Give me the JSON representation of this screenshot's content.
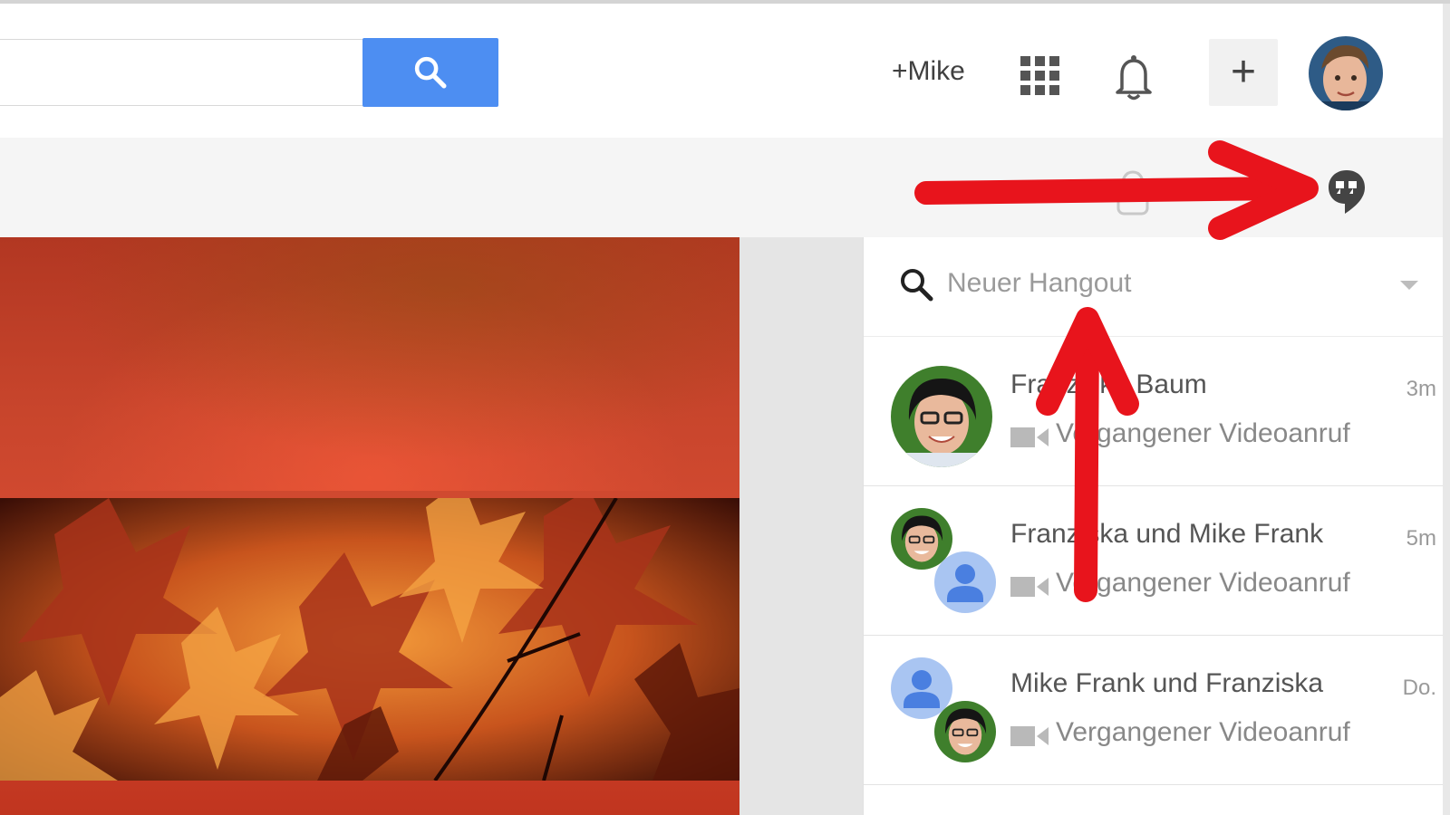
{
  "header": {
    "search_placeholder": "",
    "profile_link": "+Mike",
    "icons": [
      "search-icon",
      "apps-grid-icon",
      "notifications-bell-icon",
      "share-plus-icon",
      "avatar"
    ]
  },
  "toolbar": {
    "icons": [
      "hangouts-icon"
    ]
  },
  "hangouts": {
    "search_placeholder": "Neuer Hangout",
    "conversations": [
      {
        "title": "Franziska Baum",
        "time": "3m",
        "subtitle": "Vergangener Videoanruf"
      },
      {
        "title": "Franziska und Mike Frank",
        "time": "5m",
        "subtitle": "Vergangener Videoanruf"
      },
      {
        "title": "Mike Frank und Franziska",
        "time": "Do.",
        "subtitle": "Vergangener Videoanruf"
      }
    ]
  },
  "colors": {
    "search_button": "#4d8ef2",
    "annotation_arrow": "#e8141c",
    "placeholder_avatar": "#a9c5f2"
  }
}
